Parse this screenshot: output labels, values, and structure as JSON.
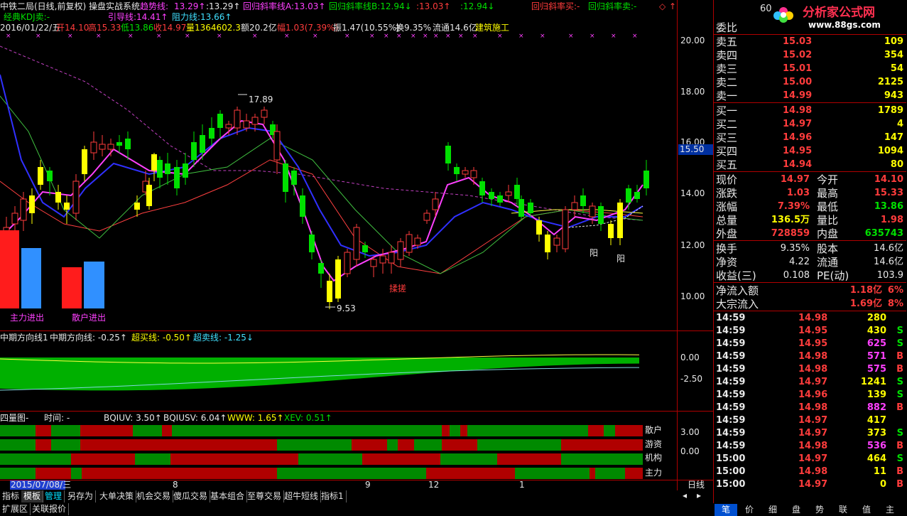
{
  "header": {
    "title": "中铁二局(日线,前复权) 操盘实战系统",
    "trend_label": "趋势线:",
    "trend_val": "13.29↑",
    "val2": ":13.29↑",
    "slope_a": "回归斜率线A:13.03↑",
    "slope_b": "回归斜率线B:12.94↓",
    "val3": ":13.03↑",
    "val4": ":12.94↓",
    "slope_buy": "回归斜率买:-",
    "slope_sell": "回归斜率卖:-",
    "kdj_label": "经典KDJ卖:-",
    "guide_line": "引导线:14.41↑",
    "resist_line": "阻力线:13.66↑",
    "info_date": "2016/01/22/五",
    "info_open": "开14.10",
    "info_high": "高15.33",
    "info_low": "低13.86",
    "info_close": "收14.97",
    "info_vol": "量1364602.3",
    "info_amt": "额20.2亿",
    "info_chg": "幅1.03(7.39%)",
    "info_amp": "振1.47(10.55%)",
    "info_turn": "换9.35%",
    "info_float": "流通14.6亿",
    "info_sector": "建筑施工"
  },
  "logo": {
    "text": "分析家公式网",
    "url": "www.88gs.com",
    "code": "60"
  },
  "main_chart": {
    "y_labels": [
      "20.00",
      "18.00",
      "16.00",
      "14.00",
      "12.00",
      "10.00"
    ],
    "price_tag": "15.50",
    "high_mark": "17.89",
    "low_mark": "9.53",
    "annot_rub": "揉搓",
    "annot_yang1": "阳",
    "annot_yang2": "阳",
    "bar_label1": "主力进出",
    "bar_label2": "散户进出"
  },
  "sub1": {
    "title": "中期方向线1",
    "mid_line": "中期方向线: -0.25↑",
    "overbuy": "超买线: -0.50↑",
    "oversell": "超卖线: -1.25↓",
    "y_labels": [
      "0.00",
      "-2.50"
    ]
  },
  "sub2": {
    "title": "四量图-",
    "time": "时间: -",
    "bqiuv": "BQIUV: 3.50↑",
    "bqiusv": "BQIUSV: 6.04↑",
    "www": "WWW: 1.65↑",
    "xev": "XEV: 0.51↑",
    "rows": [
      "散户",
      "游资",
      "机构",
      "主力"
    ],
    "y_labels": [
      "3.00",
      "0.00"
    ]
  },
  "x_axis": {
    "date_sel": "2015/07/08/三",
    "ticks": [
      "8",
      "9",
      "12",
      "1"
    ],
    "period": "日线"
  },
  "tabs": [
    "指标",
    "模板",
    "管理",
    "另存为",
    "大单决策",
    "机会交易",
    "傻瓜交易",
    "基本组合",
    "至尊交易",
    "超牛短线",
    "指标1"
  ],
  "bottom_tabs": [
    "扩展区",
    "关联报价"
  ],
  "right_tabs": [
    "笔",
    "价",
    "细",
    "盘",
    "势",
    "联",
    "值",
    "主"
  ],
  "order_book": {
    "header": "委比",
    "asks": [
      {
        "label": "卖五",
        "price": "15.03",
        "vol": "109"
      },
      {
        "label": "卖四",
        "price": "15.02",
        "vol": "354"
      },
      {
        "label": "卖三",
        "price": "15.01",
        "vol": "54"
      },
      {
        "label": "卖二",
        "price": "15.00",
        "vol": "2125"
      },
      {
        "label": "卖一",
        "price": "14.99",
        "vol": "943"
      }
    ],
    "bids": [
      {
        "label": "买一",
        "price": "14.98",
        "vol": "1789"
      },
      {
        "label": "买二",
        "price": "14.97",
        "vol": "4"
      },
      {
        "label": "买三",
        "price": "14.96",
        "vol": "147"
      },
      {
        "label": "买四",
        "price": "14.95",
        "vol": "1094"
      },
      {
        "label": "买五",
        "price": "14.94",
        "vol": "80"
      }
    ]
  },
  "quote": {
    "rows": [
      {
        "l1": "现价",
        "v1": "14.97",
        "l2": "今开",
        "v2": "14.10"
      },
      {
        "l1": "涨跌",
        "v1": "1.03",
        "l2": "最高",
        "v2": "15.33"
      },
      {
        "l1": "涨幅",
        "v1": "7.39%",
        "l2": "最低",
        "v2": "13.86"
      },
      {
        "l1": "总量",
        "v1": "136.5万",
        "l2": "量比",
        "v2": "1.98"
      },
      {
        "l1": "外盘",
        "v1": "728859",
        "l2": "内盘",
        "v2": "635743"
      }
    ],
    "rows2": [
      {
        "l1": "换手",
        "v1": "9.35%",
        "l2": "股本",
        "v2": "14.6亿"
      },
      {
        "l1": "净资",
        "v1": "4.22",
        "l2": "流通",
        "v2": "14.6亿"
      },
      {
        "l1": "收益(三)",
        "v1": "0.108",
        "l2": "PE(动)",
        "v2": "103.9"
      }
    ],
    "netflow": {
      "label": "净流入额",
      "val": "1.18亿",
      "pct": "6%"
    },
    "bigflow": {
      "label": "大宗流入",
      "val": "1.69亿",
      "pct": "8%"
    }
  },
  "ticks": [
    {
      "time": "14:59",
      "price": "14.98",
      "vol": "280",
      "side": ""
    },
    {
      "time": "14:59",
      "price": "14.95",
      "vol": "430",
      "side": "S"
    },
    {
      "time": "14:59",
      "price": "14.95",
      "vol": "625",
      "side": "S"
    },
    {
      "time": "14:59",
      "price": "14.98",
      "vol": "571",
      "side": "B"
    },
    {
      "time": "14:59",
      "price": "14.98",
      "vol": "575",
      "side": "B"
    },
    {
      "time": "14:59",
      "price": "14.97",
      "vol": "1241",
      "side": "S"
    },
    {
      "time": "14:59",
      "price": "14.96",
      "vol": "139",
      "side": "S"
    },
    {
      "time": "14:59",
      "price": "14.98",
      "vol": "882",
      "side": "B"
    },
    {
      "time": "14:59",
      "price": "14.97",
      "vol": "417",
      "side": ""
    },
    {
      "time": "14:59",
      "price": "14.97",
      "vol": "373",
      "side": "S"
    },
    {
      "time": "14:59",
      "price": "14.98",
      "vol": "536",
      "side": "B"
    },
    {
      "time": "15:00",
      "price": "14.97",
      "vol": "464",
      "side": "S"
    },
    {
      "time": "15:00",
      "price": "14.98",
      "vol": "11",
      "side": "B"
    },
    {
      "time": "15:00",
      "price": "14.97",
      "vol": "0",
      "side": "B"
    }
  ],
  "colors": {
    "up": "#ff3c3c",
    "down": "#00e000",
    "border": "#b00000"
  }
}
